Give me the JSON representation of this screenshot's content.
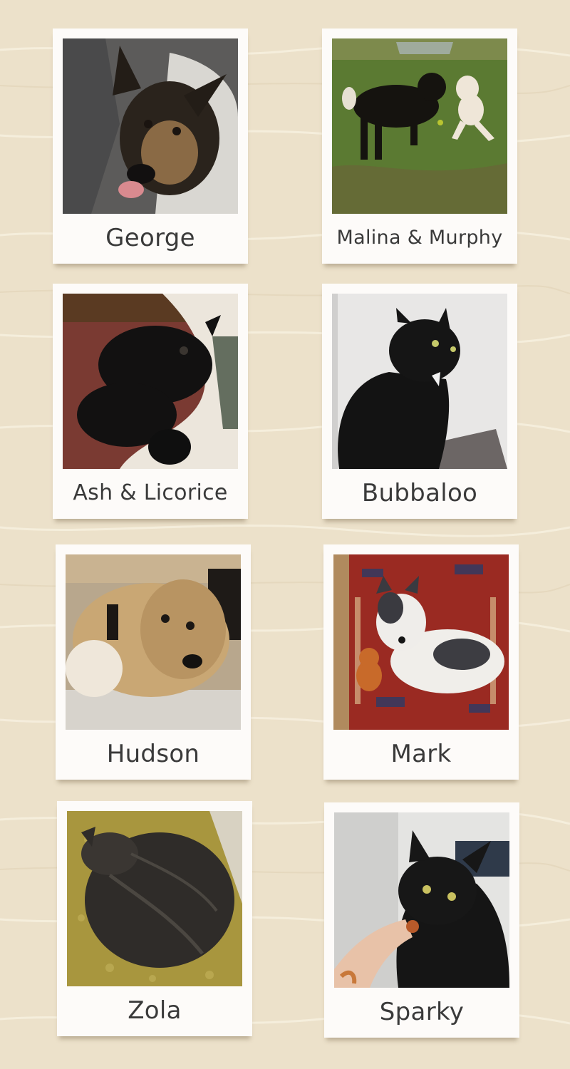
{
  "pets": [
    {
      "name": "George",
      "subject": "dog-photo"
    },
    {
      "name": "Malina & Murphy",
      "subject": "dog-photo"
    },
    {
      "name": "Ash & Licorice",
      "subject": "cat-photo"
    },
    {
      "name": "Bubbaloo",
      "subject": "cat-photo"
    },
    {
      "name": "Hudson",
      "subject": "dog-photo"
    },
    {
      "name": "Mark",
      "subject": "dog-photo"
    },
    {
      "name": "Zola",
      "subject": "cat-photo"
    },
    {
      "name": "Sparky",
      "subject": "cat-photo"
    }
  ],
  "colors": {
    "background": "#ece1ca",
    "card": "#fdfbf9",
    "caption_text": "#3a3a3a"
  }
}
